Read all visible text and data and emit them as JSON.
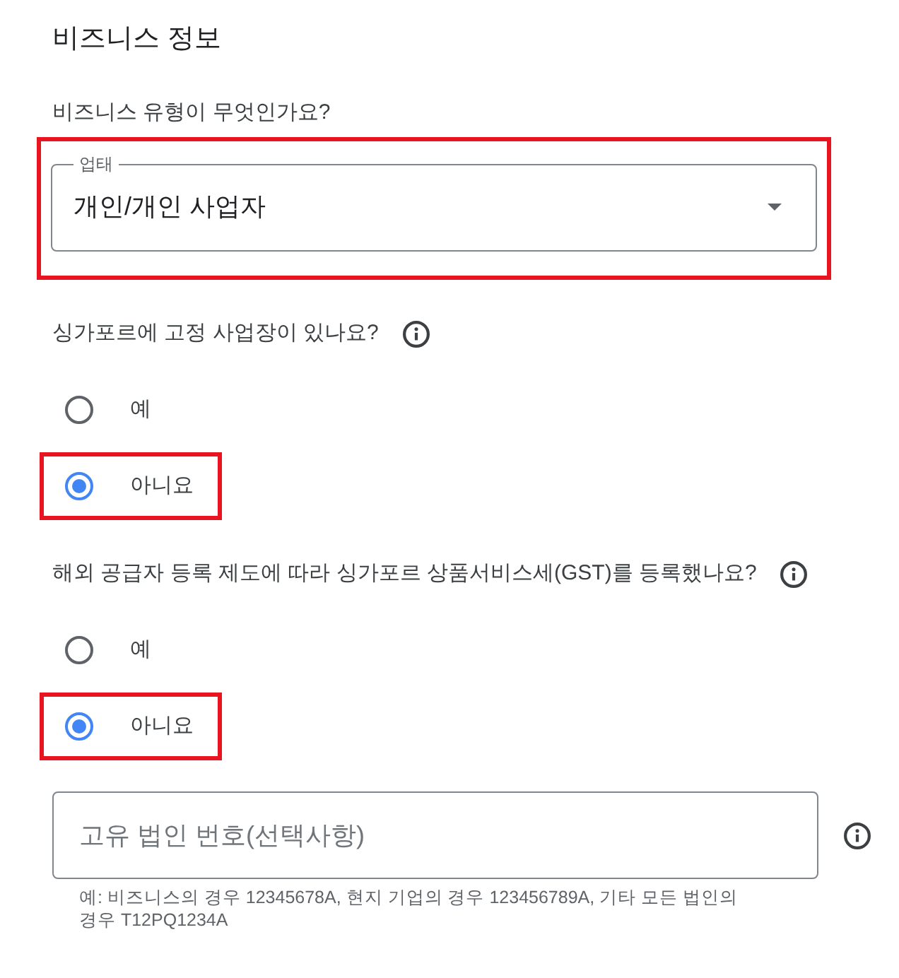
{
  "section": {
    "title": "비즈니스 정보"
  },
  "questions": [
    {
      "kind": "select",
      "prompt": "비즈니스 유형이 무엇인가요?",
      "highlighted": true,
      "field": {
        "label": "업태",
        "value": "개인/개인 사업자"
      }
    },
    {
      "kind": "radio",
      "prompt": "싱가포르에 고정 사업장이 있나요?",
      "info": true,
      "options": [
        {
          "label": "예",
          "selected": false,
          "highlighted": false
        },
        {
          "label": "아니요",
          "selected": true,
          "highlighted": true
        }
      ]
    },
    {
      "kind": "radio",
      "prompt": "해외 공급자 등록 제도에 따라 싱가포르 상품서비스세(GST)를 등록했나요?",
      "info": true,
      "options": [
        {
          "label": "예",
          "selected": false,
          "highlighted": false
        },
        {
          "label": "아니요",
          "selected": true,
          "highlighted": true
        }
      ]
    },
    {
      "kind": "text",
      "info": true,
      "field": {
        "placeholder": "고유 법인 번호(선택사항)",
        "helper": "예: 비즈니스의 경우 12345678A, 현지 기업의 경우 123456789A, 기타 모든 법인의 경우 T12PQ1234A"
      }
    }
  ]
}
